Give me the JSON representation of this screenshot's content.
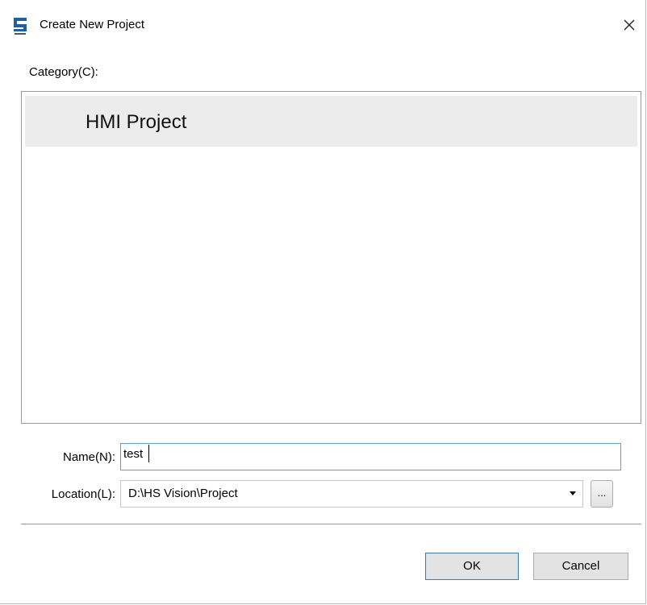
{
  "window": {
    "title": "Create New Project",
    "app_icon": "hs-vision-app-icon",
    "close_icon": "close-icon",
    "close_glyph": "✕"
  },
  "category": {
    "label": "Category(C):",
    "items": [
      {
        "label": "HMI Project",
        "selected": true
      }
    ]
  },
  "form": {
    "name_label": "Name(N):",
    "name_value": "test",
    "location_label": "Location(L):",
    "location_value": "D:\\HS Vision\\Project",
    "browse_label": "..."
  },
  "buttons": {
    "ok_label": "OK",
    "cancel_label": "Cancel"
  },
  "colors": {
    "focus_border": "#5ba0d9",
    "selected_item_bg": "#ececec",
    "default_button_border": "#3c7fb1"
  }
}
